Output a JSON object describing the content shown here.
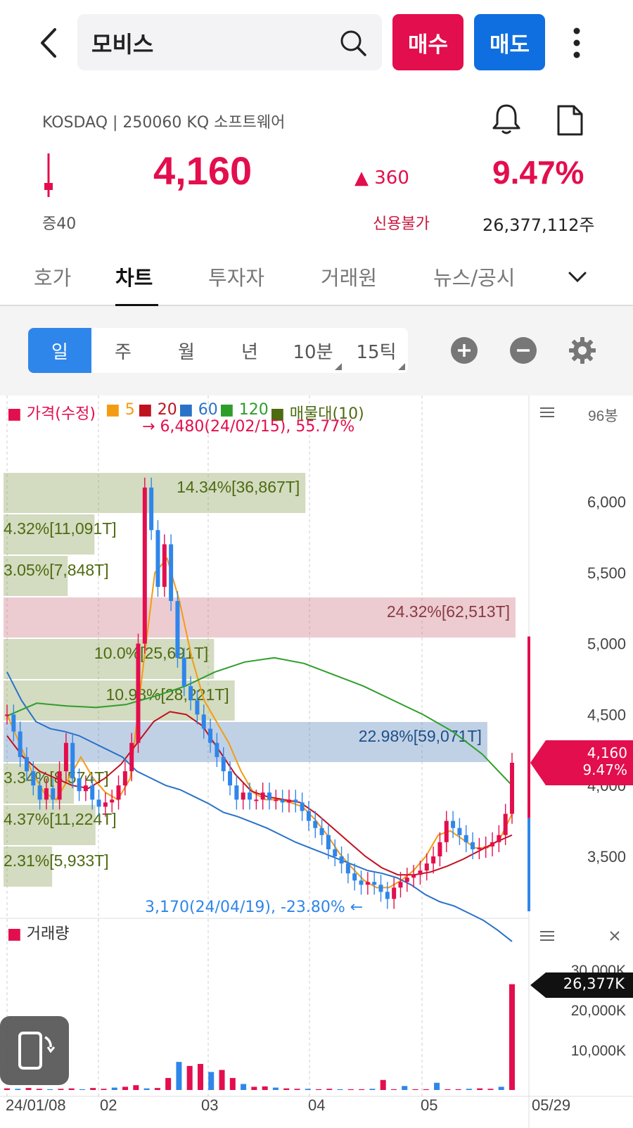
{
  "header": {
    "stock_name": "모비스",
    "buy_label": "매수",
    "sell_label": "매도"
  },
  "info": {
    "meta": "KOSDAQ | 250060 KQ 소프트웨어",
    "price": "4,160",
    "change": "360",
    "change_pct": "9.47%",
    "margin": "증40",
    "credit": "신용불가",
    "volume": "26,377,112주"
  },
  "tabs": [
    "호가",
    "차트",
    "투자자",
    "거래원",
    "뉴스/공시"
  ],
  "periods": [
    "일",
    "주",
    "월",
    "년",
    "10분",
    "15틱"
  ],
  "legend": {
    "price": "가격(수정)",
    "ma5": "5",
    "ma20": "20",
    "ma60": "60",
    "ma120": "120",
    "profile": "매물대(10)",
    "volume": "거래량"
  },
  "annotations": {
    "high": "6,480(24/02/15), 55.77%",
    "low": "3,170(24/04/19), -23.80%",
    "candles_count": "96봉",
    "current_price": "4,160",
    "current_pct": "9.47%",
    "current_volume": "26,377K"
  },
  "colors": {
    "up": "#e30e4d",
    "down": "#2f86ea",
    "ma5": "#f39c12",
    "ma20": "#c0111f",
    "ma60": "#2a72c8",
    "ma120": "#2e9e2a",
    "profile": "#4d6b10"
  },
  "chart_data": [
    {
      "type": "line",
      "title": "",
      "x": [
        "24/01/08",
        "02",
        "03",
        "04",
        "05",
        "05/29"
      ],
      "y_ticks": [
        3500,
        4000,
        4500,
        5000,
        5500,
        6000
      ],
      "ylim": [
        3000,
        6600
      ],
      "price_close": [
        4500,
        4380,
        4200,
        4100,
        4000,
        3900,
        3980,
        3900,
        4100,
        4300,
        4050,
        3960,
        4000,
        3900,
        3850,
        3880,
        3900,
        4000,
        4100,
        4300,
        5000,
        6100,
        5800,
        5400,
        5700,
        5300,
        4900,
        4700,
        4600,
        4500,
        4400,
        4300,
        4200,
        4100,
        4000,
        3900,
        3950,
        3900,
        3900,
        3950,
        3900,
        3900,
        3880,
        3900,
        3880,
        3820,
        3750,
        3700,
        3650,
        3550,
        3500,
        3450,
        3380,
        3330,
        3300,
        3320,
        3300,
        3250,
        3200,
        3280,
        3320,
        3350,
        3370,
        3400,
        3450,
        3500,
        3600,
        3750,
        3700,
        3650,
        3600,
        3550,
        3560,
        3570,
        3600,
        3650,
        3800,
        4160
      ],
      "series": [
        {
          "name": "5",
          "values": [
            4500,
            4300,
            4100,
            3950,
            3900,
            4050,
            4200,
            4050,
            3950,
            3900,
            4050,
            4800,
            5500,
            5600,
            5300,
            4900,
            4600,
            4450,
            4300,
            4100,
            3950,
            3900,
            3900,
            3880,
            3850,
            3760,
            3650,
            3520,
            3420,
            3330,
            3280,
            3280,
            3330,
            3400,
            3500,
            3650,
            3680,
            3620,
            3560,
            3560,
            3620,
            3800
          ]
        },
        {
          "name": "20",
          "values": [
            4350,
            4200,
            4100,
            4050,
            4000,
            3980,
            4050,
            4150,
            4300,
            4450,
            4520,
            4500,
            4420,
            4250,
            4080,
            3960,
            3920,
            3900,
            3880,
            3800,
            3700,
            3600,
            3500,
            3420,
            3370,
            3370,
            3390,
            3430,
            3480,
            3540,
            3600,
            3650
          ]
        },
        {
          "name": "60",
          "values": [
            4800,
            4600,
            4450,
            4400,
            4380,
            4350,
            4300,
            4250,
            4200,
            4100,
            4050,
            4000,
            3970,
            3920,
            3870,
            3810,
            3780,
            3740,
            3700,
            3650,
            3600,
            3560,
            3520,
            3480,
            3440,
            3400,
            3380,
            3350,
            3300,
            3230,
            3180,
            3150,
            3100,
            3050,
            2980,
            2900
          ]
        },
        {
          "name": "120",
          "values": [
            4490,
            4580,
            4560,
            4550,
            4570,
            4630,
            4700,
            4800,
            4870,
            4900,
            4860,
            4780,
            4700,
            4600,
            4500,
            4380,
            4220,
            4000
          ]
        }
      ],
      "price_profile": [
        {
          "pct": "14.34%",
          "value": "36,867T"
        },
        {
          "pct": "4.32%",
          "value": "11,091T"
        },
        {
          "pct": "3.05%",
          "value": "7,848T"
        },
        {
          "pct": "24.32%",
          "value": "62,513T"
        },
        {
          "pct": "10.0%",
          "value": "25,691T"
        },
        {
          "pct": "10.98%",
          "value": "28,221T"
        },
        {
          "pct": "22.98%",
          "value": "59,071T"
        },
        {
          "pct": "3.34%",
          "value": "8,574T"
        },
        {
          "pct": "4.37%",
          "value": "11,224T"
        },
        {
          "pct": "2.31%",
          "value": "5,933T"
        }
      ]
    },
    {
      "type": "bar",
      "title": "거래량",
      "y_ticks": [
        "10,000K",
        "20,000K",
        "30,000K"
      ],
      "ylim": [
        0,
        30000
      ],
      "values": [
        400,
        300,
        500,
        300,
        200,
        300,
        400,
        200,
        500,
        300,
        600,
        800,
        1200,
        400,
        500,
        3000,
        7000,
        6000,
        6500,
        4500,
        5000,
        3000,
        1500,
        800,
        900,
        600,
        400,
        300,
        300,
        200,
        300,
        200,
        200,
        200,
        300,
        2500,
        200,
        1000,
        200,
        200,
        1800,
        200,
        200,
        300,
        400,
        300,
        800,
        26377
      ]
    }
  ]
}
